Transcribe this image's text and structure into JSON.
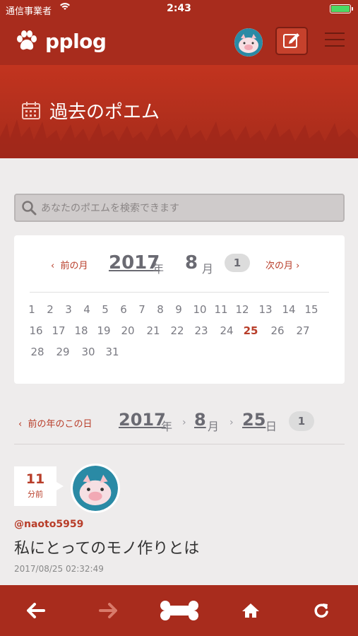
{
  "status_bar": {
    "carrier": "通信事業者",
    "time": "2:43",
    "battery_level": 1.0,
    "battery_color": "#4cd964"
  },
  "header": {
    "brand": "pplog",
    "logo_icon": "paw-icon",
    "avatar_icon": "pig-avatar-icon",
    "edit_icon": "pencil-square-icon",
    "menu_icon": "hamburger-menu-icon",
    "bg_color": "#a82c1d"
  },
  "banner": {
    "title": "過去のポエム",
    "icon": "calendar-icon"
  },
  "search": {
    "placeholder": "あなたのポエムを検索できます",
    "icon": "search-icon"
  },
  "calendar": {
    "prev_month": "前の月",
    "next_month": "次の月",
    "year": "2017",
    "year_unit": "年",
    "month": "8",
    "month_unit": "月",
    "month_count": "1",
    "days": [
      "1",
      "2",
      "3",
      "4",
      "5",
      "6",
      "7",
      "8",
      "9",
      "10",
      "11",
      "12",
      "13",
      "14",
      "15",
      "16",
      "17",
      "18",
      "19",
      "20",
      "21",
      "22",
      "23",
      "24",
      "25",
      "26",
      "27",
      "28",
      "29",
      "30",
      "31"
    ],
    "selected_day": "25",
    "accent_color": "#b83d29"
  },
  "date_line": {
    "prev_year_same_day": "前の年のこの日",
    "year": "2017",
    "year_unit": "年",
    "month": "8",
    "month_unit": "月",
    "day": "25",
    "day_unit": "日",
    "count": "1"
  },
  "post": {
    "elapsed_value": "11",
    "elapsed_unit": "分前",
    "username": "@naoto5959",
    "title": "私にとってのモノ作りとは",
    "datetime": "2017/08/25 02:32:49",
    "avatar_icon": "pig-avatar-icon"
  },
  "tab_bar": {
    "items": [
      "back-arrow-icon",
      "forward-arrow-icon",
      "bone-icon",
      "home-icon",
      "reload-icon"
    ]
  }
}
